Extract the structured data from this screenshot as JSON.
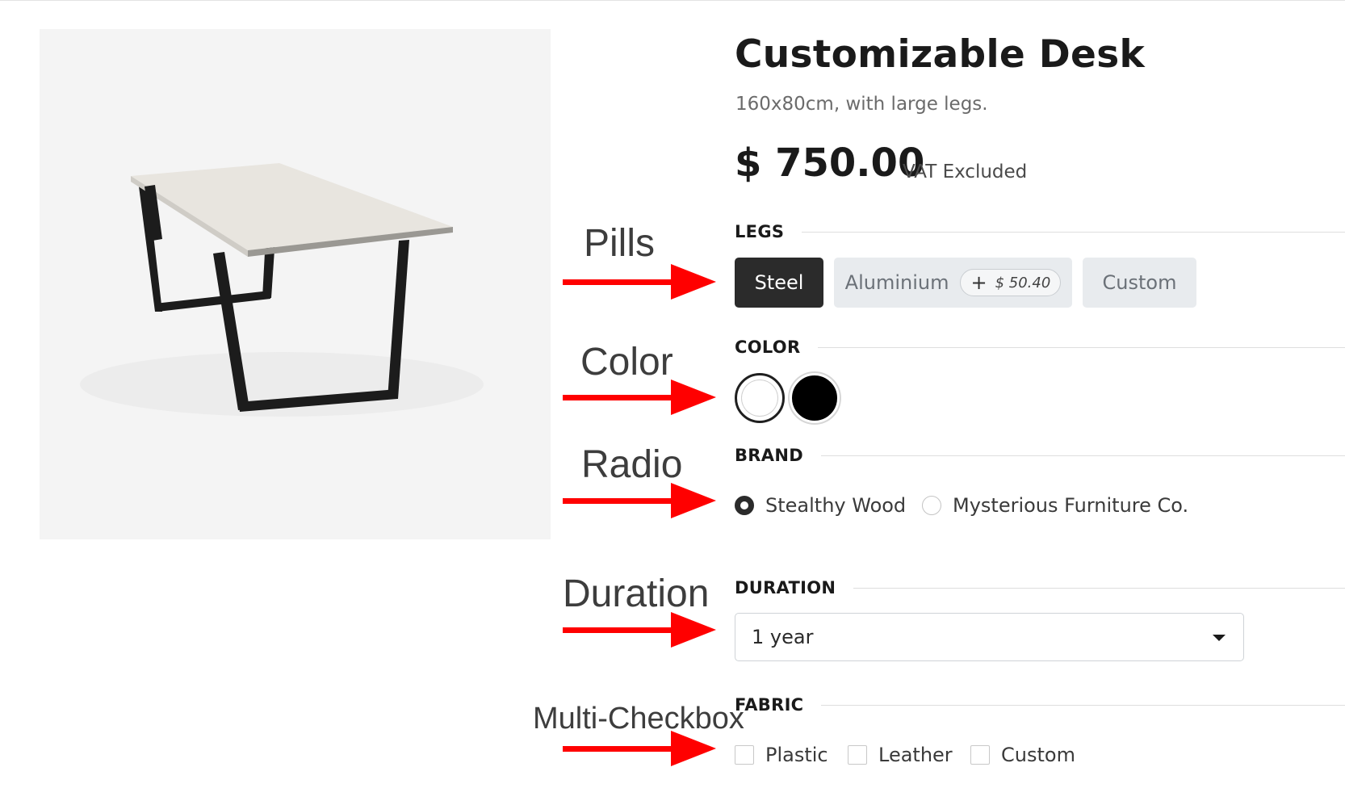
{
  "product": {
    "title": "Customizable Desk",
    "subtitle": "160x80cm, with large legs.",
    "price": "$ 750.00",
    "price_note": "VAT Excluded",
    "image_alt": "desk-photo"
  },
  "annotations": {
    "pills": "Pills",
    "color": "Color",
    "radio": "Radio",
    "duration": "Duration",
    "multi_checkbox": "Multi-Checkbox",
    "arrow_color": "#ff0000"
  },
  "legs": {
    "label": "LEGS",
    "options": [
      {
        "label": "Steel",
        "selected": true
      },
      {
        "label": "Aluminium",
        "extra": "$ 50.40",
        "extra_prefix": "+",
        "selected": false
      },
      {
        "label": "Custom",
        "selected": false
      }
    ]
  },
  "color": {
    "label": "COLOR",
    "options": [
      {
        "name": "White",
        "hex": "#ffffff",
        "selected": true
      },
      {
        "name": "Black",
        "hex": "#000000",
        "selected": false
      }
    ]
  },
  "brand": {
    "label": "BRAND",
    "options": [
      {
        "label": "Stealthy Wood",
        "selected": true
      },
      {
        "label": "Mysterious Furniture Co.",
        "selected": false
      }
    ]
  },
  "duration": {
    "label": "DURATION",
    "value": "1 year"
  },
  "fabric": {
    "label": "FABRIC",
    "options": [
      {
        "label": "Plastic",
        "checked": false
      },
      {
        "label": "Leather",
        "checked": false
      },
      {
        "label": "Custom",
        "checked": false
      }
    ]
  }
}
